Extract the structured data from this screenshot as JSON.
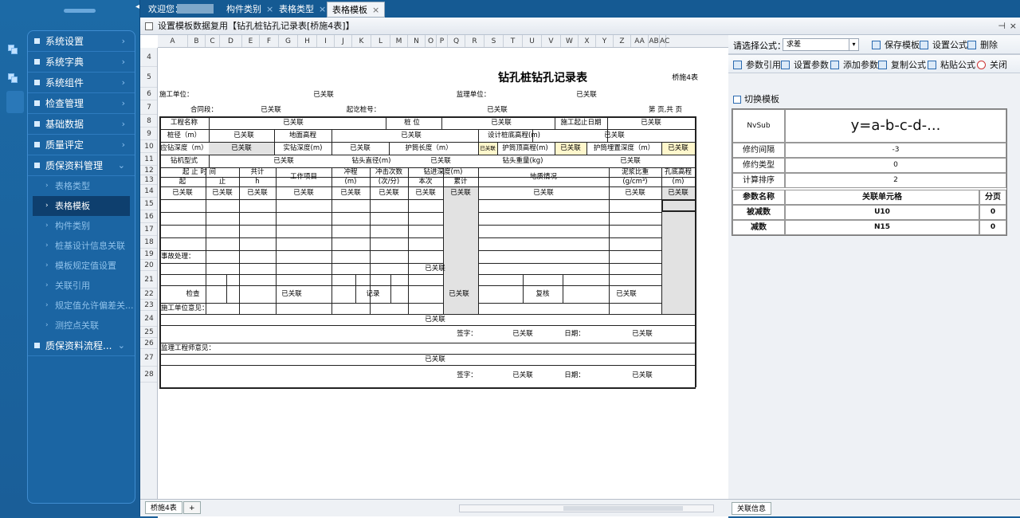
{
  "sidebar": {
    "menu": [
      {
        "label": "系统设置",
        "chev": "›"
      },
      {
        "label": "系统字典",
        "chev": "›"
      },
      {
        "label": "系统组件",
        "chev": "›"
      },
      {
        "label": "检查管理",
        "chev": "›"
      },
      {
        "label": "基础数据",
        "chev": "›"
      },
      {
        "label": "质量评定",
        "chev": "›"
      },
      {
        "label": "质保资料管理",
        "chev": "⌄"
      }
    ],
    "submenu": [
      "表格类型",
      "表格模板",
      "构件类别",
      "桩基设计信息关联",
      "模板规定值设置",
      "关联引用",
      "规定值允许偏差关...",
      "测控点关联"
    ],
    "last_menu": {
      "label": "质保资料流程...",
      "chev": "⌄"
    }
  },
  "topbar": {
    "welcome": "欢迎您：",
    "tabs": [
      {
        "label": "构件类别",
        "close": "×"
      },
      {
        "label": "表格类型",
        "close": "×"
      },
      {
        "label": "表格模板",
        "close": "×"
      }
    ]
  },
  "title": "设置模板数据复用【钻孔桩钻孔记录表[桥施4表]】",
  "title_controls": {
    "pin": "⊣",
    "close": "×"
  },
  "columns": [
    "A",
    "B",
    "C",
    "D",
    "E",
    "F",
    "G",
    "H",
    "I",
    "J",
    "K",
    "L",
    "M",
    "N",
    "O",
    "P",
    "Q",
    "R",
    "S",
    "T",
    "U",
    "V",
    "W",
    "X",
    "Y",
    "Z",
    "AA",
    "AB",
    "AC"
  ],
  "rows": [
    "4",
    "5",
    "6",
    "7",
    "8",
    "9",
    "10",
    "11",
    "12",
    "13",
    "14",
    "15",
    "16",
    "17",
    "18",
    "19",
    "20",
    "21",
    "22",
    "23",
    "24",
    "25",
    "26",
    "27",
    "28"
  ],
  "sheet": {
    "title": "钻孔桩钻孔记录表",
    "form_no": "桥施4表",
    "construction_unit": "施工单位：",
    "supervision_unit": "监理单位：",
    "contract": "合同段：",
    "pile_no": "起讫桩号：",
    "page": "第  页,共  页",
    "linked": "已关联",
    "project_name": "工程名称",
    "pile_pos": "桩    位",
    "start_end_date": "施工起止日期",
    "pile_dia": "桩径（m）",
    "ground_elev": "地面高程",
    "design_bottom": "设计桩底高程(m)",
    "drill_depth": "应钻深度（m）",
    "actual_depth": "实钻深度(m)",
    "casing_len": "护筒长度（m）",
    "casing_top": "护筒顶高程(m)",
    "casing_bury": "护筒埋置深度（m）",
    "rig_type": "钻机型式",
    "bit_dia": "钻头直径(m)",
    "bit_weight": "钻头重量(kg)",
    "start_stop_time": "起  止  时  间",
    "start": "起",
    "stop": "止",
    "total": "共计",
    "hour": "h",
    "work_item": "工作项目",
    "stroke": "冲程",
    "stroke_unit": "(m)",
    "impacts": "冲击次数",
    "impacts_unit": "(次/分)",
    "advance": "钻进深度(m)",
    "this_time": "本次",
    "cumulative": "累计",
    "geology": "地质情况",
    "mud_density": "泥浆比重",
    "mud_unit": "(g/cm³)",
    "hole_bottom": "孔底高程",
    "hole_unit": "(m)",
    "incident": "事故处理：",
    "inspection": "检查",
    "record": "记录",
    "review": "复核",
    "contractor_opinion": "施工单位意见：",
    "signature": "签字：",
    "date": "日期：",
    "supervisor_opinion": "监理工程师意见："
  },
  "sheet_tabs": {
    "active": "桥施4表",
    "add": "+"
  },
  "right_panel": {
    "select_label": "请选择公式：",
    "formula_value": "求差",
    "buttons_row1": [
      "保存模板",
      "设置公式",
      "删除"
    ],
    "buttons_row2": [
      "参数引用",
      "设置参数",
      "添加参数",
      "复制公式",
      "粘贴公式",
      "关闭"
    ],
    "switch_template": "切换模板",
    "func_name": "NvSub",
    "formula": "y=a-b-c-d-...",
    "props": [
      {
        "label": "修约间隔",
        "value": "-3"
      },
      {
        "label": "修约类型",
        "value": "0"
      },
      {
        "label": "计算排序",
        "value": "2"
      }
    ],
    "param_headers": [
      "参数名称",
      "关联单元格",
      "分页"
    ],
    "params": [
      {
        "name": "被减数",
        "cell": "U10",
        "page": "0"
      },
      {
        "name": "减数",
        "cell": "N15",
        "page": "0"
      }
    ],
    "bottom_tab": "关联信息"
  }
}
